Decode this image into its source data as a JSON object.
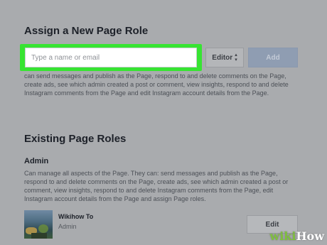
{
  "assign": {
    "title": "Assign a New Page Role",
    "input_placeholder": "Type a name or email",
    "role_select_value": "Editor",
    "add_label": "Add",
    "role_description": "can send messages and publish as the Page, respond to and delete comments on the Page, create ads, see which admin created a post or comment, view insights, respond to and delete Instagram comments from the Page and edit Instagram account details from the Page."
  },
  "existing": {
    "title": "Existing Page Roles",
    "role_name": "Admin",
    "role_description": "Can manage all aspects of the Page. They can: send messages and publish as the Page, respond to and delete comments on the Page, create ads, see which admin created a post or comment, view insights, respond to and delete Instagram comments from the Page, edit Instagram account details from the Page and assign Page roles.",
    "member": {
      "name": "Wikihow To",
      "role": "Admin",
      "edit_label": "Edit"
    }
  },
  "watermark": {
    "part1": "wiki",
    "part2": "How"
  },
  "colors": {
    "highlight": "#37e432",
    "overlay_gray": "#a9abae",
    "add_button": "#8f9db2"
  }
}
